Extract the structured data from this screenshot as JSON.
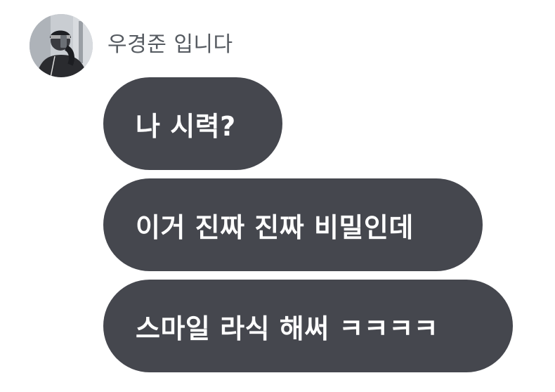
{
  "sender": {
    "name": "우경준 입니다"
  },
  "messages": [
    {
      "text": "나 시력?"
    },
    {
      "text": "이거 진짜 진짜 비밀인데"
    },
    {
      "text": "스마일 라식 해써 ㅋㅋㅋㅋ"
    }
  ],
  "colors": {
    "bubble": "#45474e",
    "bubble_text": "#ffffff",
    "sender_text": "#555a60",
    "background": "#ffffff"
  }
}
